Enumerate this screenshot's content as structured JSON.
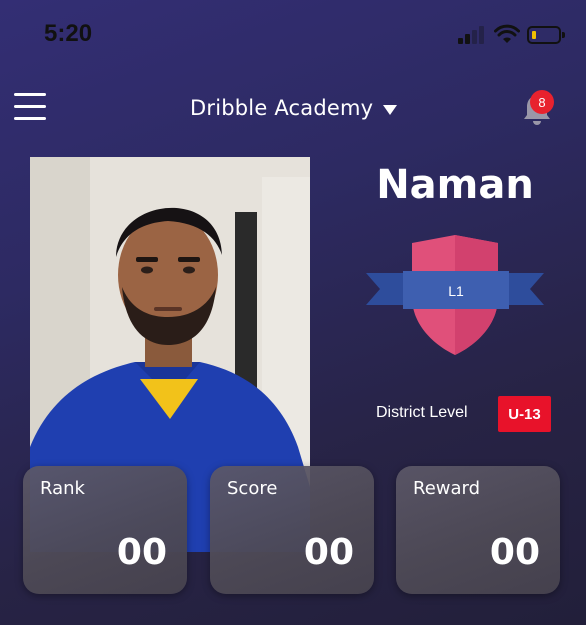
{
  "status_bar": {
    "time": "5:20",
    "signal_icon": "cell-signal-icon",
    "wifi_icon": "wifi-icon",
    "battery_icon": "battery-icon"
  },
  "header": {
    "menu_icon": "hamburger-menu-icon",
    "academy_name": "Dribble Academy",
    "dropdown_icon": "caret-down-icon",
    "notification_icon": "bell-icon",
    "notification_count": "8"
  },
  "profile": {
    "name": "Naman",
    "level": "L1",
    "district_label": "District Level",
    "age_group": "U-13"
  },
  "stats": [
    {
      "label": "Rank",
      "value": "00"
    },
    {
      "label": "Score",
      "value": "00"
    },
    {
      "label": "Reward",
      "value": "00"
    }
  ],
  "colors": {
    "background": "#2f2b6a",
    "emblem_pink": "#e0507a",
    "emblem_ribbon": "#3e5fb0",
    "badge_red": "#e8122a",
    "notification_red": "#e8222e"
  }
}
